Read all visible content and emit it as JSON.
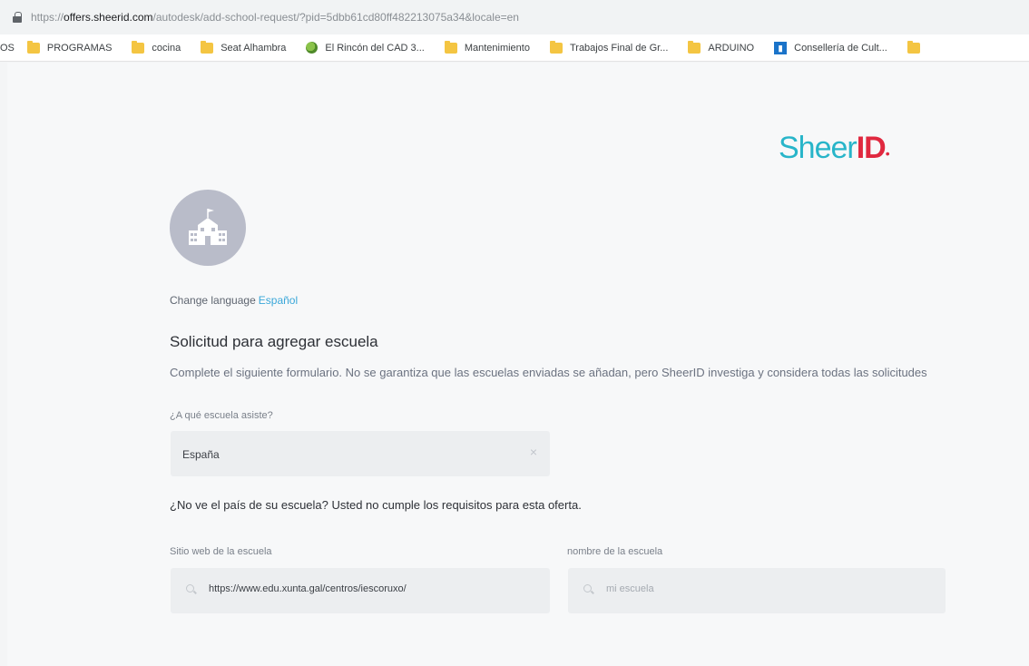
{
  "browser": {
    "url_prefix": "https://",
    "url_host": "offers.sheerid.com",
    "url_path": "/autodesk/add-school-request/?pid=5dbb61cd80ff482213075a34&locale=en",
    "bookmarks": [
      {
        "label": "OS",
        "icon": "cut-off"
      },
      {
        "label": "PROGRAMAS",
        "icon": "folder-icon"
      },
      {
        "label": "cocina",
        "icon": "folder-icon"
      },
      {
        "label": "Seat Alhambra",
        "icon": "folder-icon"
      },
      {
        "label": "El Rincón del CAD 3...",
        "icon": "plant-favicon"
      },
      {
        "label": "Mantenimiento",
        "icon": "folder-icon"
      },
      {
        "label": "Trabajos Final de Gr...",
        "icon": "folder-icon"
      },
      {
        "label": "ARDUINO",
        "icon": "folder-icon"
      },
      {
        "label": "Consellería de Cult...",
        "icon": "blue-favicon"
      },
      {
        "label": "",
        "icon": "folder-icon"
      }
    ]
  },
  "brand": {
    "logo_sheer": "Sheer",
    "logo_id": "ID",
    "logo_mark": "•"
  },
  "form": {
    "change_language_label": "Change language",
    "language_link": "Español",
    "title": "Solicitud para agregar escuela",
    "description": "Complete el siguiente formulario. No se garantiza que las escuelas enviadas se añadan, pero SheerID investiga y considera todas las solicitudes",
    "country_label": "¿A qué escuela asiste?",
    "country_value": "España",
    "clear_glyph": "×",
    "notice": "¿No ve el país de su escuela? Usted no cumple los requisitos para esta oferta.",
    "website_label": "Sitio web de la escuela",
    "website_value": "https://www.edu.xunta.gal/centros/iescoruxo/",
    "school_name_label": "nombre de la escuela",
    "school_name_placeholder": "mi escuela"
  },
  "colors": {
    "brand_teal": "#28b5c9",
    "brand_red": "#e0283f",
    "link": "#3aa7d9",
    "avatar": "#b9bcc9"
  }
}
